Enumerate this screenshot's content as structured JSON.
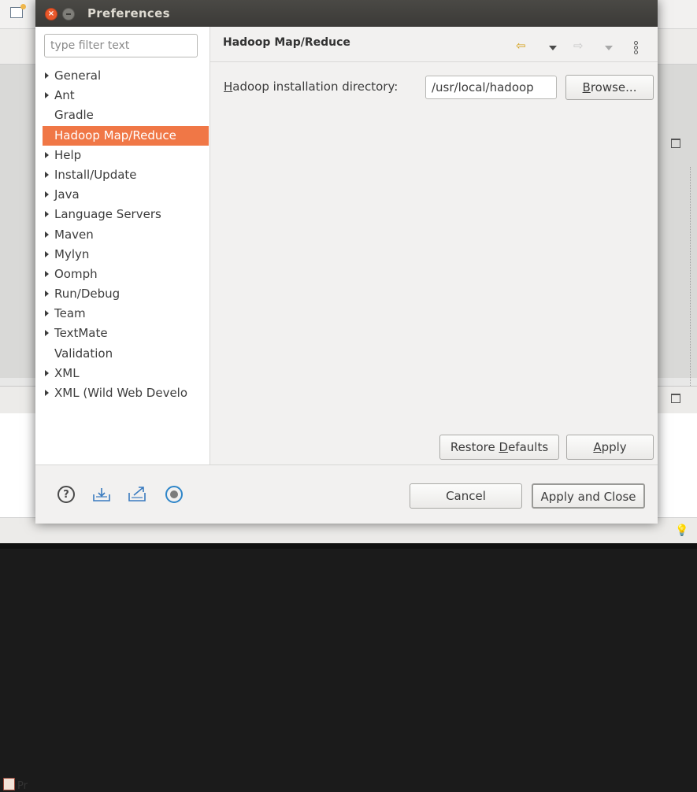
{
  "background": {
    "problems_tab_label": "Pr"
  },
  "dialog": {
    "title": "Preferences",
    "filter_placeholder": "type filter text",
    "tree": [
      {
        "label": "General",
        "expandable": true
      },
      {
        "label": "Ant",
        "expandable": true
      },
      {
        "label": "Gradle",
        "expandable": false
      },
      {
        "label": "Hadoop Map/Reduce",
        "expandable": false,
        "selected": true
      },
      {
        "label": "Help",
        "expandable": true
      },
      {
        "label": "Install/Update",
        "expandable": true
      },
      {
        "label": "Java",
        "expandable": true
      },
      {
        "label": "Language Servers",
        "expandable": true
      },
      {
        "label": "Maven",
        "expandable": true
      },
      {
        "label": "Mylyn",
        "expandable": true
      },
      {
        "label": "Oomph",
        "expandable": true
      },
      {
        "label": "Run/Debug",
        "expandable": true
      },
      {
        "label": "Team",
        "expandable": true
      },
      {
        "label": "TextMate",
        "expandable": true
      },
      {
        "label": "Validation",
        "expandable": false
      },
      {
        "label": "XML",
        "expandable": true
      },
      {
        "label": "XML (Wild Web Develo",
        "expandable": true
      }
    ],
    "page": {
      "title": "Hadoop Map/Reduce",
      "dir_label_mnemonic": "H",
      "dir_label_rest": "adoop installation directory:",
      "dir_value": "/usr/local/hadoop",
      "browse_mnemonic": "B",
      "browse_rest": "rowse..."
    },
    "buttons": {
      "restore_pre": "Restore ",
      "restore_mnemonic": "D",
      "restore_post": "efaults",
      "apply_mnemonic": "A",
      "apply_rest": "pply",
      "cancel": "Cancel",
      "apply_close": "Apply and Close"
    }
  },
  "colors": {
    "selection": "#f07746",
    "titlebar": "#3c3b37"
  }
}
